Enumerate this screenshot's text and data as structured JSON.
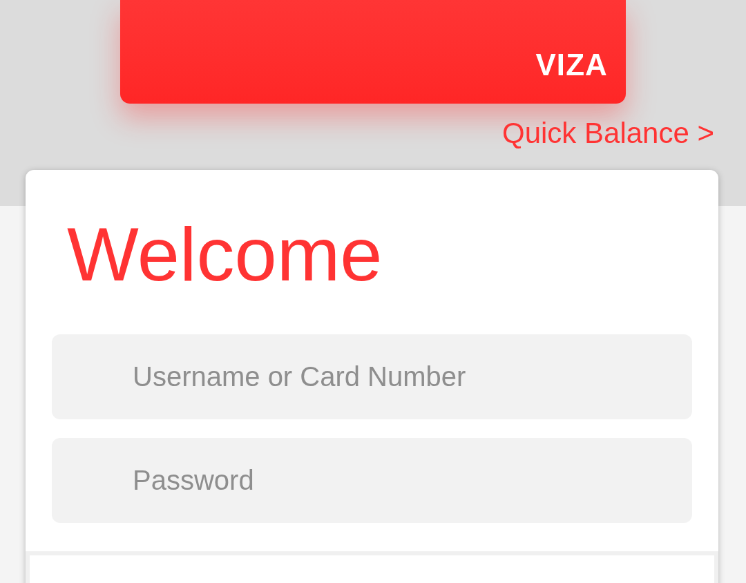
{
  "card": {
    "brand": "VIZA"
  },
  "quick_balance": {
    "label": "Quick Balance >"
  },
  "login": {
    "title": "Welcome",
    "fields": [
      {
        "placeholder": "Username or Card Number"
      },
      {
        "placeholder": "Password"
      }
    ]
  }
}
